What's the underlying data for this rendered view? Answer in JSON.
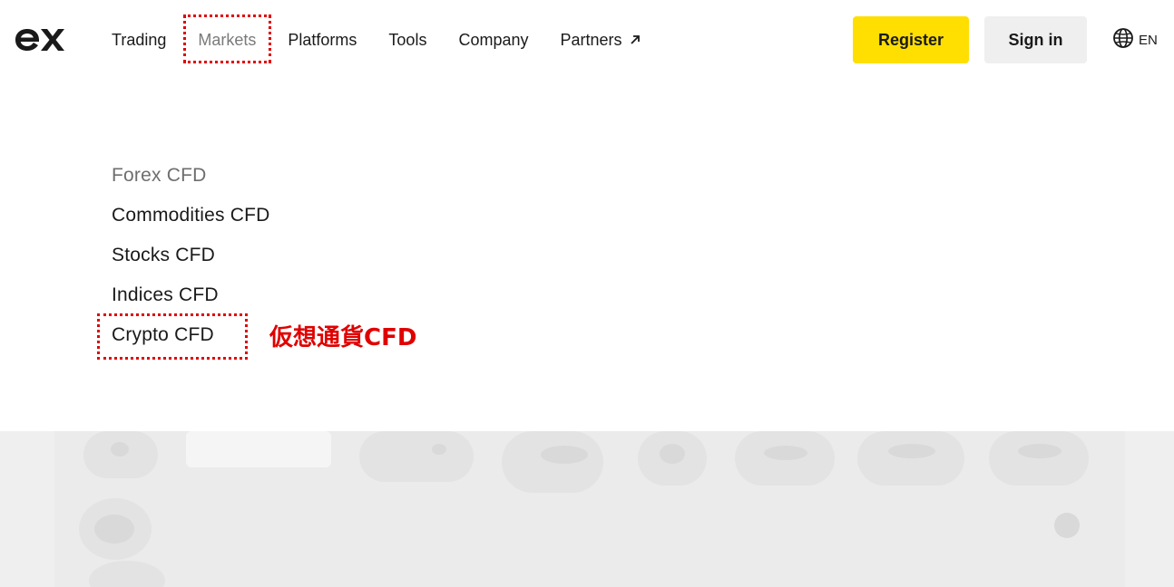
{
  "header": {
    "logo_icon": "exness-logo-icon",
    "nav": [
      {
        "label": "Trading"
      },
      {
        "label": "Markets",
        "active": true
      },
      {
        "label": "Platforms"
      },
      {
        "label": "Tools"
      },
      {
        "label": "Company"
      },
      {
        "label": "Partners",
        "icon": "arrow-up-right-icon"
      }
    ],
    "register_label": "Register",
    "signin_label": "Sign in",
    "language": {
      "icon": "globe-icon",
      "label": "EN"
    }
  },
  "markets_menu": {
    "items": [
      {
        "label": "Forex CFD"
      },
      {
        "label": "Commodities CFD"
      },
      {
        "label": "Stocks CFD"
      },
      {
        "label": "Indices CFD"
      },
      {
        "label": "Crypto CFD"
      }
    ]
  },
  "annotation": {
    "text": "仮想通貨CFD",
    "color": "#e00000"
  },
  "colors": {
    "accent_yellow": "#ffde02",
    "signin_bg": "#efefef",
    "highlight_red": "#e00000"
  }
}
